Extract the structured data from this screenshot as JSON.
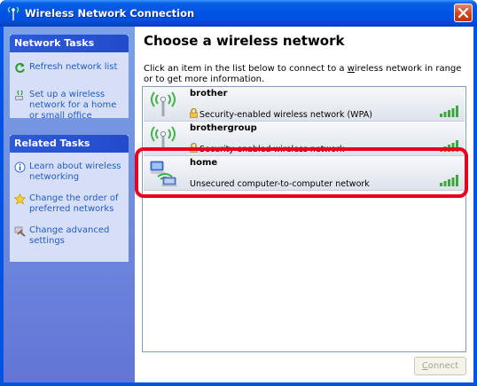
{
  "window": {
    "title": "Wireless Network Connection",
    "close_icon": "close-icon",
    "title_icon": "wireless-antenna-icon"
  },
  "network_tasks": {
    "header": "Network Tasks",
    "items": [
      {
        "label": "Refresh network list",
        "icon": "refresh-icon"
      },
      {
        "label": "Set up a wireless network for a home or small office",
        "icon": "setup-wizard-icon"
      }
    ]
  },
  "related_tasks": {
    "header": "Related Tasks",
    "items": [
      {
        "label": "Learn about wireless networking",
        "icon": "info-icon"
      },
      {
        "label": "Change the order of preferred networks",
        "icon": "star-icon"
      },
      {
        "label": "Change advanced settings",
        "icon": "tools-icon"
      }
    ]
  },
  "main": {
    "heading": "Choose a wireless network",
    "instructions_pre": "Click an item in the list below to connect to a ",
    "instructions_link": "w",
    "instructions_post": "ireless network in range or to get more information."
  },
  "networks": [
    {
      "name": "brother",
      "description": "Security-enabled wireless network (WPA)",
      "secured": true,
      "type": "access-point",
      "signal_bars": 5
    },
    {
      "name": "brothergroup",
      "description": "Security-enabled wireless network",
      "secured": true,
      "type": "access-point",
      "signal_bars": 5
    },
    {
      "name": "home",
      "description": "Unsecured computer-to-computer network",
      "secured": false,
      "type": "ad-hoc",
      "signal_bars": 5,
      "selected": true
    }
  ],
  "connect_button": {
    "label_pre": "",
    "label_underlined": "C",
    "label_post": "onnect",
    "enabled": false
  },
  "colors": {
    "title_bar": "#0054e3",
    "highlight": "#e8001c",
    "link": "#215dc6",
    "side_panel": "#7ba2e7"
  }
}
